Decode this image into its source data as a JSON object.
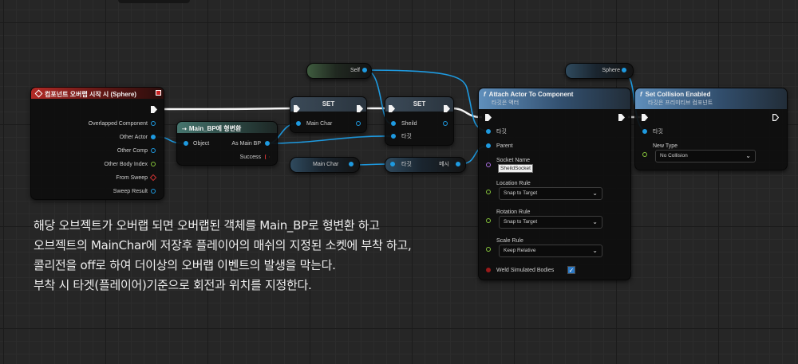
{
  "event_node": {
    "title": "컴포넌트 오버랩 시작 시 (Sphere)",
    "outputs": [
      "Overlapped Component",
      "Other Actor",
      "Other Comp",
      "Other Body Index",
      "From Sweep",
      "Sweep Result"
    ]
  },
  "cast_node": {
    "title": "Main_BP에 형변환",
    "object_label": "Object",
    "as_label": "As Main BP",
    "success_label": "Success"
  },
  "set_node_1": {
    "title": "SET",
    "pin_label": "Main Char"
  },
  "set_node_2": {
    "title": "SET",
    "pin_label": "Sheild",
    "target_label": "타깃"
  },
  "self_node": {
    "label": "Self"
  },
  "sphere_node": {
    "label": "Sphere"
  },
  "mainchar_getter": {
    "label": "Main Char"
  },
  "mesh_getter": {
    "target_label": "타깃",
    "output_label": "메시"
  },
  "attach_node": {
    "title": "Attach Actor To Component",
    "subtitle": "타깃은 액터",
    "target_label": "타깃",
    "parent_label": "Parent",
    "socket_label": "Socket Name",
    "socket_value": "SheildSocket",
    "location_label": "Location Rule",
    "location_value": "Snap to Target",
    "rotation_label": "Rotation Rule",
    "rotation_value": "Snap to Target",
    "scale_label": "Scale Rule",
    "scale_value": "Keep Relative",
    "weld_label": "Weld Simulated Bodies"
  },
  "collision_node": {
    "title": "Set Collision Enabled",
    "subtitle": "타깃은 프리미티브 컴포넌트",
    "target_label": "타깃",
    "new_type_label": "New Type",
    "new_type_value": "No Collision"
  },
  "caption": {
    "line1": "해당 오브젝트가 오버랩 되면 오버랩된 객체를 Main_BP로 형변환 하고",
    "line2": "오브젝트의 MainChar에 저장후 플레이어의 매쉬의 지정된 소켓에 부착 하고,",
    "line3": "콜리전을 off로 하여 더이상의 오버랩 이벤트의 발생을 막는다.",
    "line4": "부착 시 타겟(플레이어)기준으로 회전과 위치를 지정한다."
  },
  "colors": {
    "object_pin": "#1e9ae0",
    "exec_wire": "#ffffff",
    "event_header": "#b22a26",
    "function_header": "#5f8fbc"
  },
  "icons": [
    "event-icon",
    "function-icon",
    "cast-icon",
    "checkmark-icon",
    "chevron-down-icon"
  ]
}
